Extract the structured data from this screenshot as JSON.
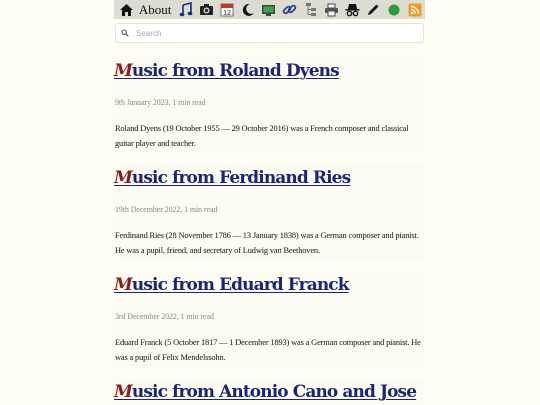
{
  "nav": {
    "about_label": "About",
    "icons": [
      "home-icon",
      "music-note-icon",
      "camera-icon",
      "calendar-icon",
      "moon-icon",
      "link-icon",
      "tree-icon",
      "printer-icon",
      "incognito-icon",
      "pen-icon",
      "green-dot-icon",
      "rss-icon"
    ],
    "calendar_day": "12"
  },
  "search": {
    "placeholder": "Search"
  },
  "posts": [
    {
      "dropcap": "M",
      "title_rest": "usic from Roland Dyens",
      "meta": "9th January 2023, 1 min read",
      "summary": "Roland Dyens (19 October 1955 — 29 October 2016) was a French composer and classical guitar player and teacher."
    },
    {
      "dropcap": "M",
      "title_rest": "usic from Ferdinand Ries",
      "meta": "19th December 2022, 1 min read",
      "summary": "Ferdinand Ries (28 November 1786 — 13 January 1838) was a German composer and pianist. He was a pupil, friend, and secretary of Ludwig van Beethoven."
    },
    {
      "dropcap": "M",
      "title_rest": "usic from Eduard Franck",
      "meta": "3rd December 2022, 1 min read",
      "summary": "Eduard Franck (5 October 1817 — 1 December 1893) was a German composer and pianist. He was a pupil of Felix Mendelssohn."
    },
    {
      "dropcap": "M",
      "title_rest": "usic from Antonio Cano and Jose"
    }
  ],
  "colors": {
    "title": "#1a237e",
    "dropcap": "#8b1c1c",
    "nav_bg": "#dcdcd0",
    "page_bg": "#fefef4"
  }
}
